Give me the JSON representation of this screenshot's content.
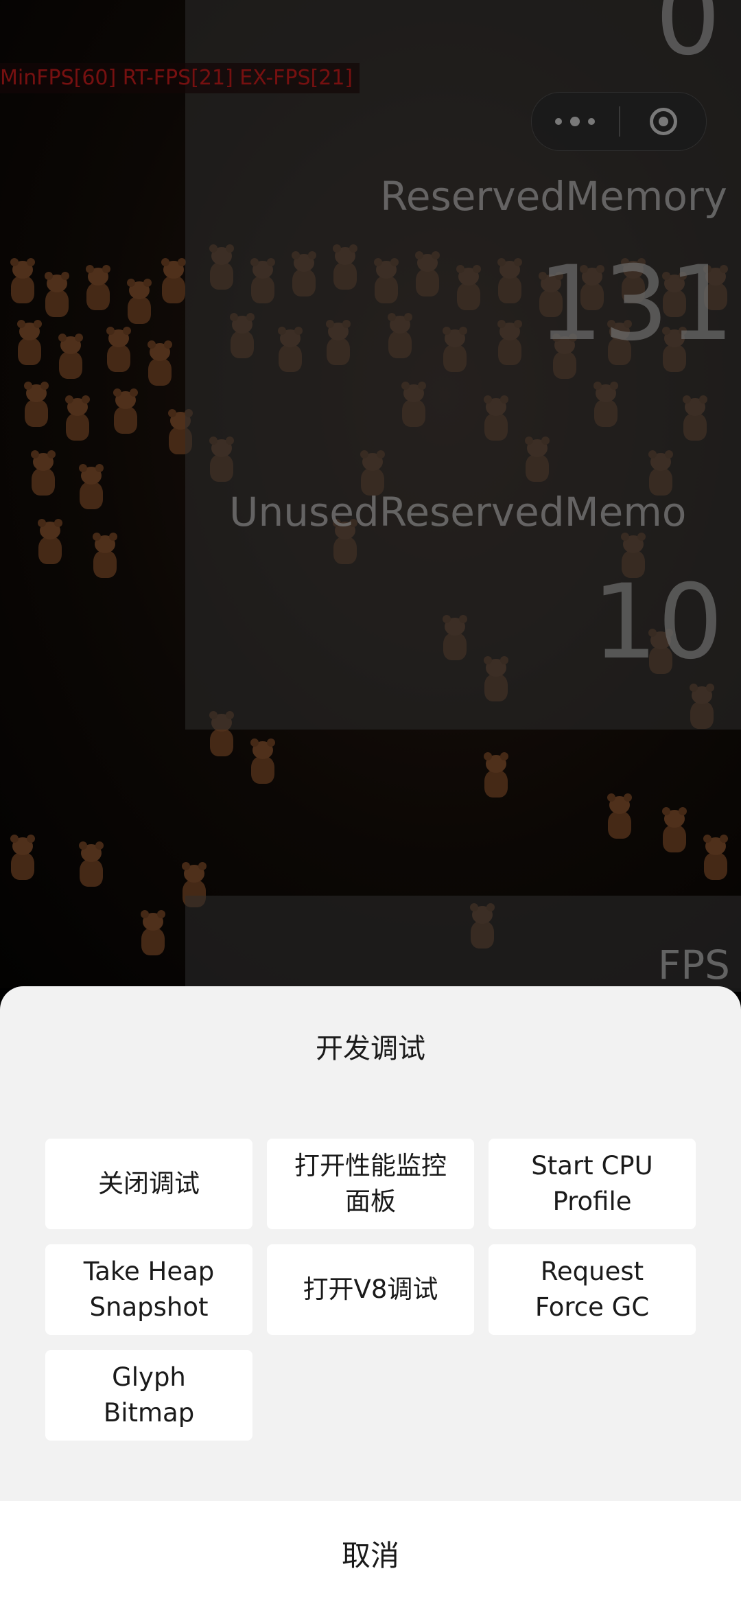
{
  "game_overlay": {
    "fps_debug_text": "MinFPS[60] RT-FPS[21] EX-FPS[21]",
    "top_value": "0",
    "reserved_memory_label": "ReservedMemory",
    "reserved_memory_value": "131",
    "unused_reserved_label": "UnusedReservedMemo",
    "unused_reserved_value": "10",
    "fps_label": "FPS"
  },
  "capsule_menu": {
    "more_icon": "more-dots-icon",
    "close_icon": "target-circle-icon"
  },
  "action_sheet": {
    "title": "开发调试",
    "buttons": [
      {
        "label": "关闭调试"
      },
      {
        "label": "打开性能监控\n面板"
      },
      {
        "label": "Start CPU\nProfile"
      },
      {
        "label": "Take Heap\nSnapshot"
      },
      {
        "label": "打开V8调试"
      },
      {
        "label": "Request\nForce GC"
      },
      {
        "label": "Glyph\nBitmap"
      }
    ],
    "cancel_label": "取消"
  },
  "colors": {
    "sheet_background": "#f2f2f2",
    "button_background": "#ffffff",
    "fps_debug_text": "#b61a1a"
  }
}
